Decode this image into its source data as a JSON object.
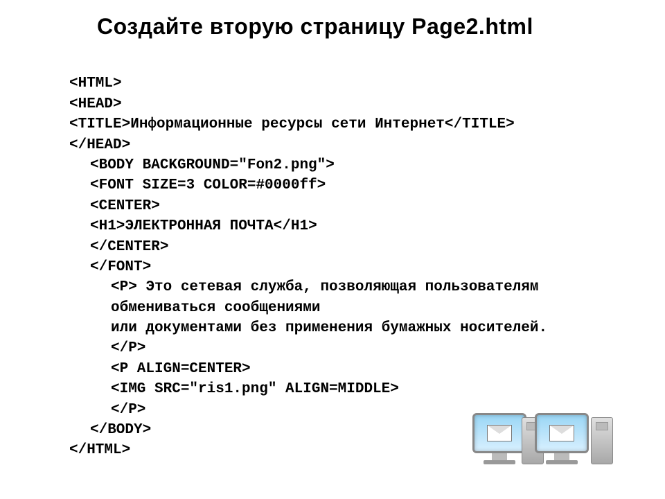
{
  "title": "Создайте вторую страницу Page2.html",
  "code": {
    "l1": "<HTML>",
    "l2": "<HEAD>",
    "l3a": "<TITLE>",
    "l3b": "Информационные ресурсы сети Интернет",
    "l3c": "</TITLE>",
    "l4": "</HEAD>",
    "l5": "<BODY BACKGROUND=\"Fon2.png\">",
    "l6": "<FONT SIZE=3 COLOR=#0000ff>",
    "l7": "<CENTER>",
    "l8a": "<H1>",
    "l8b": "ЭЛЕКТРОННАЯ ПОЧТА",
    "l8c": "</H1>",
    "l9": "</CENTER>",
    "l10": "</FONT>",
    "l11a": "<P>",
    "l11b": " Это сетевая служба, позволяющая пользователям",
    "l12": "обмениваться сообщениями",
    "l13": "или документами без применения бумажных носителей.",
    "l14": "</P>",
    "l15": "<P ALIGN=CENTER>",
    "l16": "<IMG SRC=\"ris1.png\" ALIGN=MIDDLE>",
    "l17": "</P>",
    "l18": "</BODY>",
    "l19": "</HTML>"
  }
}
